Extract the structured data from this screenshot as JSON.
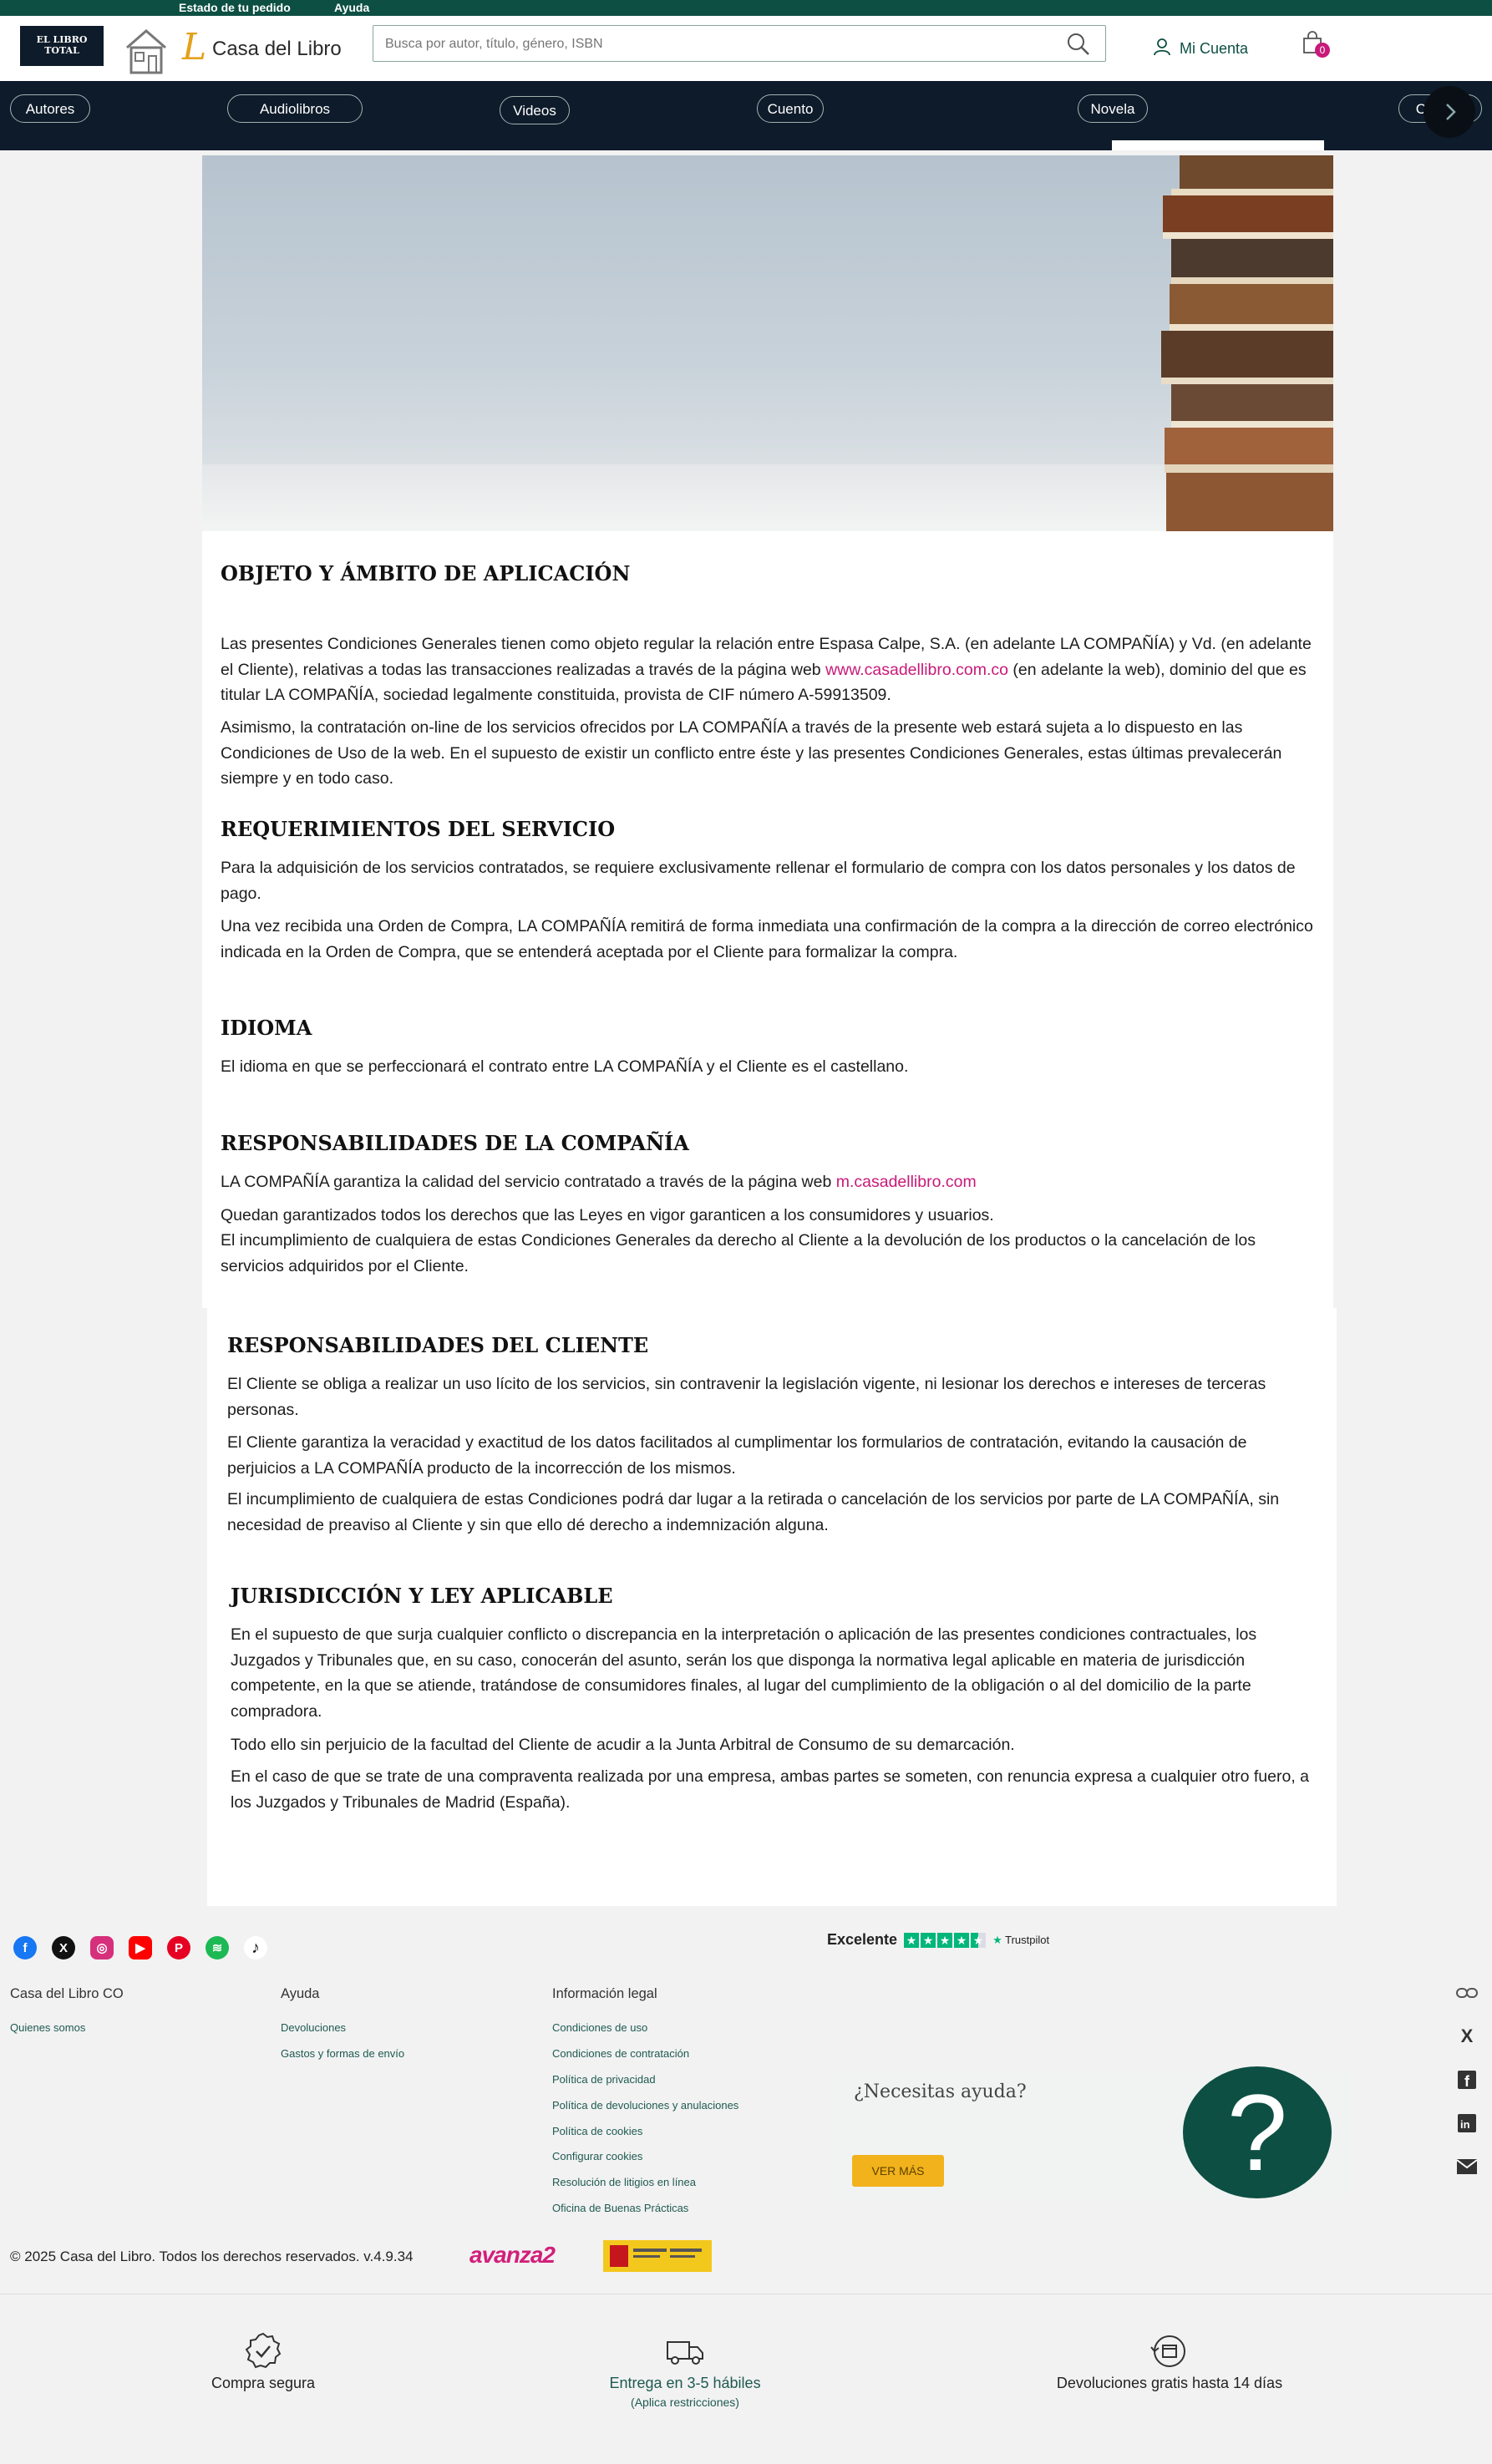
{
  "topbar": {
    "order_status": "Estado de tu pedido",
    "help": "Ayuda"
  },
  "header": {
    "partner_logo_text": "EL LIBRO TOTAL",
    "brand_name": "Casa del Libro",
    "search_placeholder": "Busca por autor, título, género, ISBN",
    "account_label": "Mi Cuenta",
    "cart_count": "0"
  },
  "nav": {
    "items": [
      "Autores",
      "Audiolibros",
      "Videos",
      "Cuento",
      "Novela",
      "Crónica"
    ]
  },
  "sections": [
    {
      "title": "OBJETO Y ÁMBITO DE APLICACIÓN"
    },
    {
      "title": "REQUERIMIENTOS DEL SERVICIO"
    },
    {
      "title": "IDIOMA"
    },
    {
      "title": "RESPONSABILIDADES DE LA COMPAÑÍA"
    },
    {
      "title": "RESPONSABILIDADES DEL CLIENTE"
    },
    {
      "title": "JURISDICCIÓN Y LEY APLICABLE"
    }
  ],
  "text": {
    "objeto_p1a": "Las presentes Condiciones Generales tienen como objeto regular la relación entre Espasa Calpe, S.A. (en adelante LA COMPAÑÍA) y Vd. (en adelante el Cliente), relativas a todas las transacciones realizadas a través de la página web ",
    "objeto_p1_link": "www.casadellibro.com.co",
    "objeto_p1b": " (en adelante la web), dominio del que es titular LA COMPAÑÍA, sociedad legalmente constituida, provista de CIF número A-59913509.",
    "objeto_p2": "Asimismo, la contratación on-line de los servicios ofrecidos por LA COMPAÑÍA a través de la presente web estará sujeta a lo dispuesto en las Condiciones de Uso de la web. En el supuesto de existir un conflicto entre éste y las presentes Condiciones Generales, estas últimas prevalecerán siempre y en todo caso.",
    "req_p1": "Para la adquisición de los servicios contratados, se requiere exclusivamente rellenar el formulario de compra con los datos personales y los datos de pago.",
    "req_p2": "Una vez recibida una Orden de Compra, LA COMPAÑÍA remitirá de forma inmediata una confirmación de la compra a la dirección de correo electrónico indicada en la Orden de Compra, que se entenderá aceptada por el Cliente para formalizar la compra.",
    "idioma_p1": "El idioma en que se perfeccionará el contrato entre LA COMPAÑÍA y el Cliente es el castellano.",
    "comp_p1a": "LA COMPAÑÍA garantiza la calidad del servicio contratado a través de la página web ",
    "comp_p1_link": "m.casadellibro.com",
    "comp_p2": "Quedan garantizados todos los derechos que las Leyes en vigor garanticen a los consumidores y usuarios.",
    "comp_p3": "El incumplimiento de cualquiera de estas Condiciones Generales da derecho al Cliente a la devolución de los productos o la cancelación de los servicios adquiridos por el Cliente.",
    "cli_p1": "El Cliente se obliga a realizar un uso lícito de los servicios, sin contravenir la legislación vigente, ni lesionar los derechos e intereses de terceras personas.",
    "cli_p2": "El Cliente garantiza la veracidad y exactitud de los datos facilitados al cumplimentar los formularios de contratación, evitando la causación de perjuicios a LA COMPAÑÍA producto de la incorrección de los mismos.",
    "cli_p3": "El incumplimiento de cualquiera de estas Condiciones podrá dar lugar a la retirada o cancelación de los servicios por parte de LA COMPAÑÍA, sin necesidad de preaviso al Cliente y sin que ello dé derecho a indemnización alguna.",
    "jur_p1": "En el supuesto de que surja cualquier conflicto o discrepancia en la interpretación o aplicación de las presentes condiciones contractuales, los Juzgados y Tribunales que, en su caso, conocerán del asunto, serán los que disponga la normativa legal aplicable en materia de jurisdicción competente, en la que se atiende, tratándose de consumidores finales, al lugar del cumplimiento de la obligación o al del domicilio de la parte compradora.",
    "jur_p2": "Todo ello sin perjuicio de la facultad del Cliente de acudir a la Junta Arbitral de Consumo de su demarcación.",
    "jur_p3": "En el caso de que se trate de una compraventa realizada por una empresa, ambas partes se someten, con renuncia expresa a cualquier otro fuero, a los Juzgados y Tribunales de Madrid (España)."
  },
  "footer": {
    "trustpilot_label": "Excelente",
    "trustpilot_brand": "Trustpilot",
    "social_icons": [
      "facebook-icon",
      "x-icon",
      "instagram-icon",
      "youtube-icon",
      "pinterest-icon",
      "spotify-icon",
      "tiktok-icon"
    ],
    "col1_title": "Casa del Libro CO",
    "col1_links": [
      "Quienes somos"
    ],
    "col2_title": "Ayuda",
    "col2_links": [
      "Devoluciones",
      "Gastos y formas de envío"
    ],
    "col3_title": "Información legal",
    "col3_links": [
      "Condiciones de uso",
      "Condiciones de contratación",
      "Política de privacidad",
      "Política de devoluciones y anulaciones",
      "Política de cookies",
      "Configurar cookies",
      "Resolución de litigios en línea",
      "Oficina de Buenas Prácticas"
    ],
    "help_question": "¿Necesitas ayuda?",
    "help_button": "VER MÁS",
    "help_symbol": "?",
    "copyright": "© 2025 Casa del Libro. Todos los derechos reservados. v.4.9.34",
    "avanza_logo": "avanza2",
    "features": [
      {
        "label": "Compra segura",
        "sub": ""
      },
      {
        "label": "Entrega en 3-5 hábiles",
        "sub": "(Aplica restricciones)"
      },
      {
        "label": "Devoluciones gratis hasta 14 días",
        "sub": ""
      }
    ]
  },
  "colors": {
    "brand_green": "#0d4f43",
    "nav_bg": "#0e1b2a",
    "link_pink": "#c81a7a",
    "help_button": "#f2b21b"
  }
}
